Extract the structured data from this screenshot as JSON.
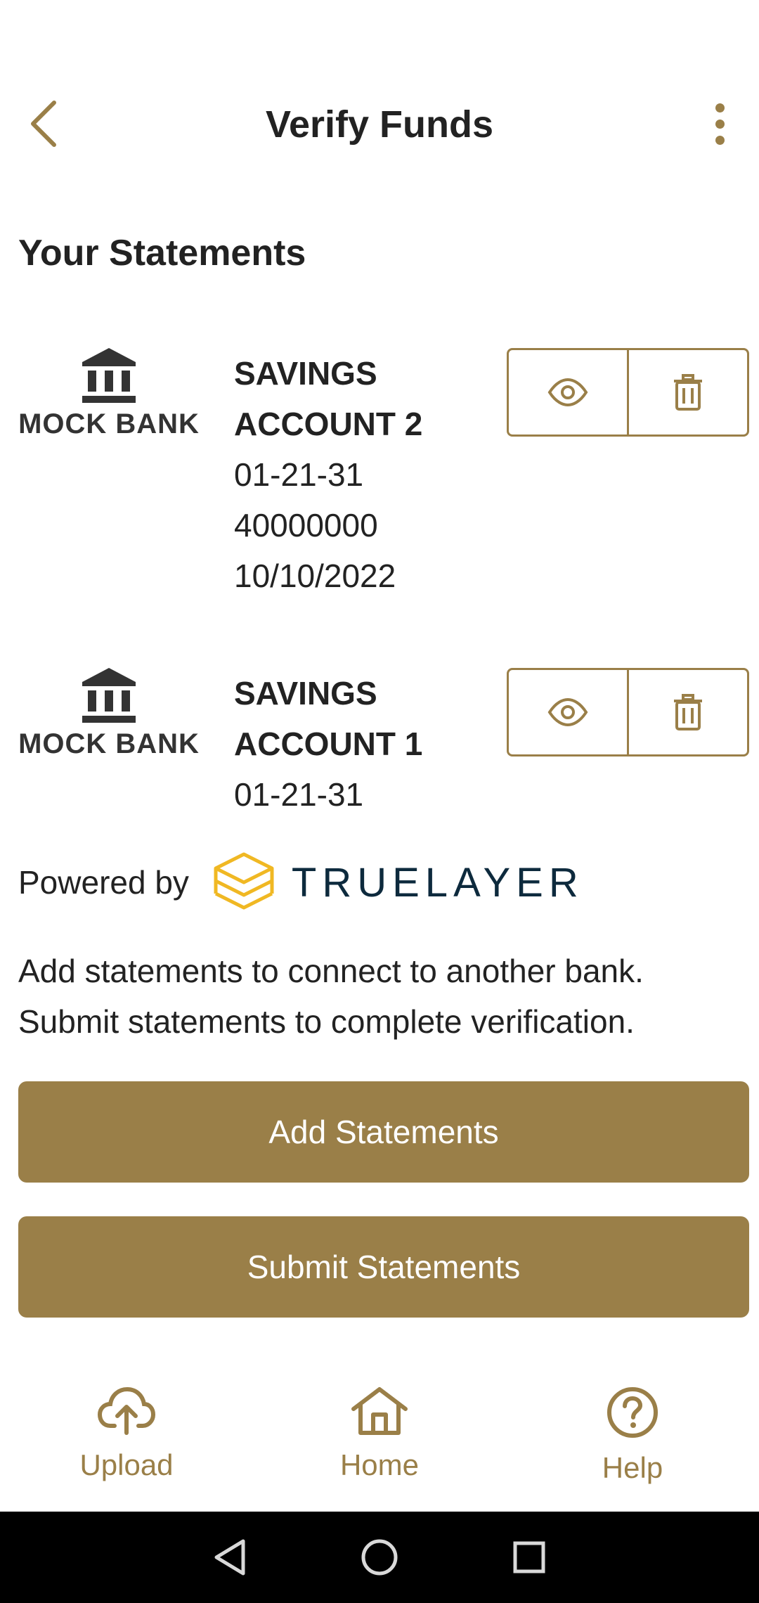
{
  "header": {
    "title": "Verify Funds"
  },
  "section_title": "Your Statements",
  "statements": [
    {
      "bank_name": "MOCK BANK",
      "account_name_line1": "SAVINGS",
      "account_name_line2": "ACCOUNT 2",
      "sort_code": "01-21-31",
      "account_number": "40000000",
      "date": "10/10/2022"
    },
    {
      "bank_name": "MOCK BANK",
      "account_name_line1": "SAVINGS",
      "account_name_line2": "ACCOUNT 1",
      "sort_code": "01-21-31"
    }
  ],
  "powered_by": {
    "label": "Powered by",
    "brand": "TRUELAYER"
  },
  "info": {
    "line1": "Add statements to connect to another bank.",
    "line2": "Submit statements to complete verification."
  },
  "buttons": {
    "add": "Add Statements",
    "submit": "Submit Statements"
  },
  "bottom_nav": [
    {
      "label": "Upload",
      "icon": "cloud-upload-icon"
    },
    {
      "label": "Home",
      "icon": "home-icon"
    },
    {
      "label": "Help",
      "icon": "help-circle-icon"
    }
  ],
  "colors": {
    "accent": "#9a7f48",
    "truelayer_gold": "#f0b823",
    "truelayer_navy": "#0d2a3d"
  }
}
